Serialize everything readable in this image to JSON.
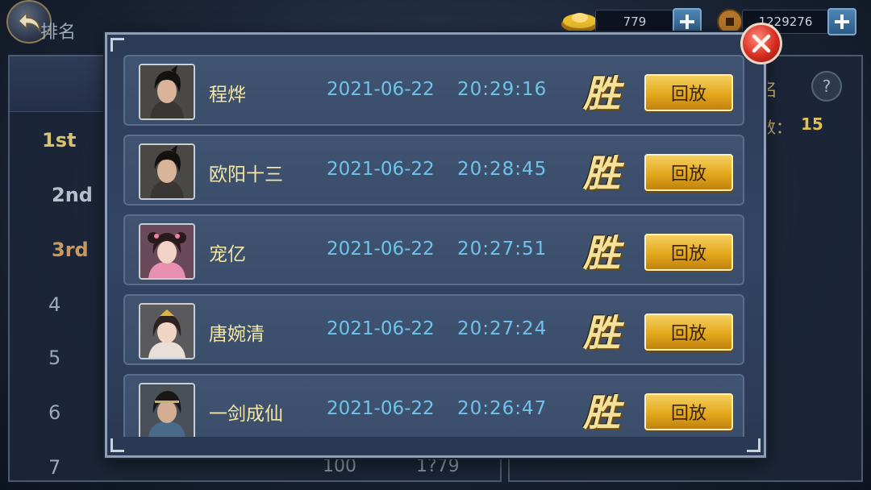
{
  "currency": {
    "ingot": {
      "value": "779"
    },
    "coin": {
      "value": "1229276"
    }
  },
  "ranking": {
    "header": "排名",
    "ranks": [
      "1st",
      "2nd",
      "3rd",
      "4",
      "5",
      "6",
      "7"
    ],
    "row7_fragments": [
      "100",
      "1?79"
    ]
  },
  "right_panel": {
    "title_fragment": "名",
    "count_label": "数：",
    "count_value": "15"
  },
  "records": [
    {
      "name": "程烨",
      "date": "2021-06-22",
      "time": "20:29:16",
      "result": "胜",
      "replay_label": "回放",
      "avatar": "male-swordsman"
    },
    {
      "name": "欧阳十三",
      "date": "2021-06-22",
      "time": "20:28:45",
      "result": "胜",
      "replay_label": "回放",
      "avatar": "male-swordsman"
    },
    {
      "name": "宠亿",
      "date": "2021-06-22",
      "time": "20:27:51",
      "result": "胜",
      "replay_label": "回放",
      "avatar": "female-pink"
    },
    {
      "name": "唐婉清",
      "date": "2021-06-22",
      "time": "20:27:24",
      "result": "胜",
      "replay_label": "回放",
      "avatar": "female-tiara"
    },
    {
      "name": "一剑成仙",
      "date": "2021-06-22",
      "time": "20:26:47",
      "result": "胜",
      "replay_label": "回放",
      "avatar": "male-headband"
    }
  ]
}
